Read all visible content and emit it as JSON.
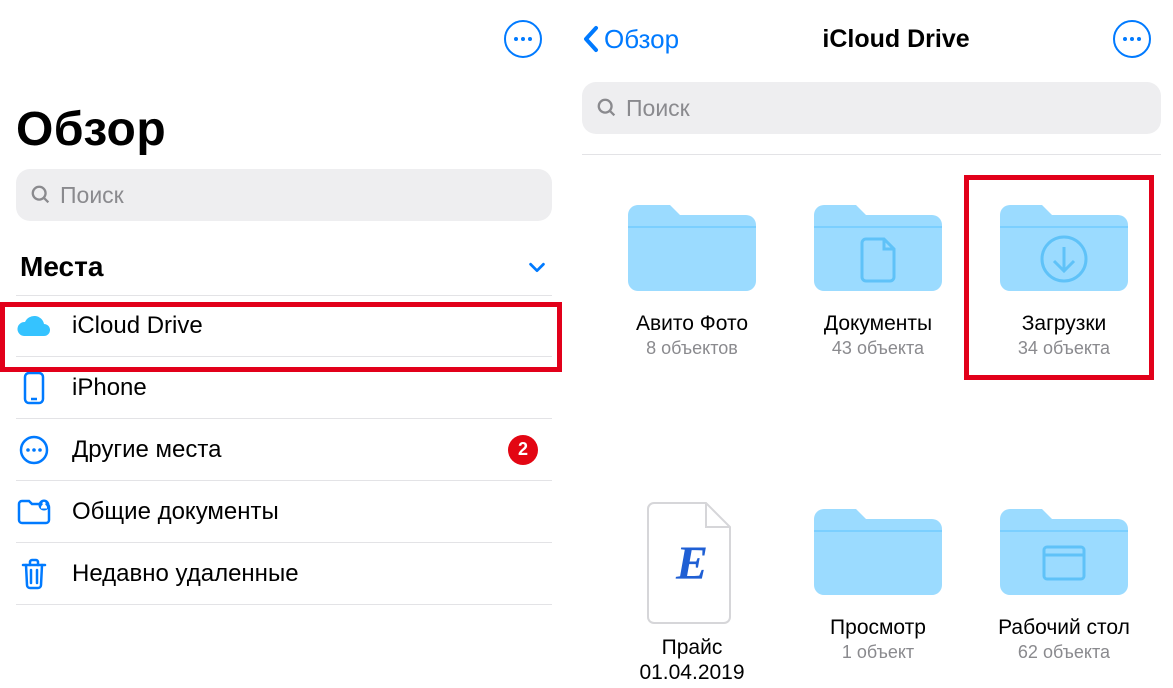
{
  "left": {
    "title": "Обзор",
    "search_placeholder": "Поиск",
    "section": "Места",
    "items": [
      {
        "id": "icloud",
        "label": "iCloud Drive",
        "badge": null
      },
      {
        "id": "iphone",
        "label": "iPhone",
        "badge": null
      },
      {
        "id": "other",
        "label": "Другие места",
        "badge": "2"
      },
      {
        "id": "shared",
        "label": "Общие документы",
        "badge": null
      },
      {
        "id": "trash",
        "label": "Недавно удаленные",
        "badge": null
      }
    ]
  },
  "right": {
    "back_label": "Обзор",
    "title": "iCloud Drive",
    "search_placeholder": "Поиск",
    "tiles": [
      {
        "type": "folder-plain",
        "name": "Авито Фото",
        "sub": "8 объектов"
      },
      {
        "type": "folder-doc",
        "name": "Документы",
        "sub": "43 объекта"
      },
      {
        "type": "folder-download",
        "name": "Загрузки",
        "sub": "34 объекта"
      },
      {
        "type": "file-e",
        "name": "Прайс 01.04.2019",
        "sub": ""
      },
      {
        "type": "folder-plain",
        "name": "Просмотр",
        "sub": "1 объект"
      },
      {
        "type": "folder-desktop",
        "name": "Рабочий стол",
        "sub": "62 объекта"
      }
    ]
  }
}
